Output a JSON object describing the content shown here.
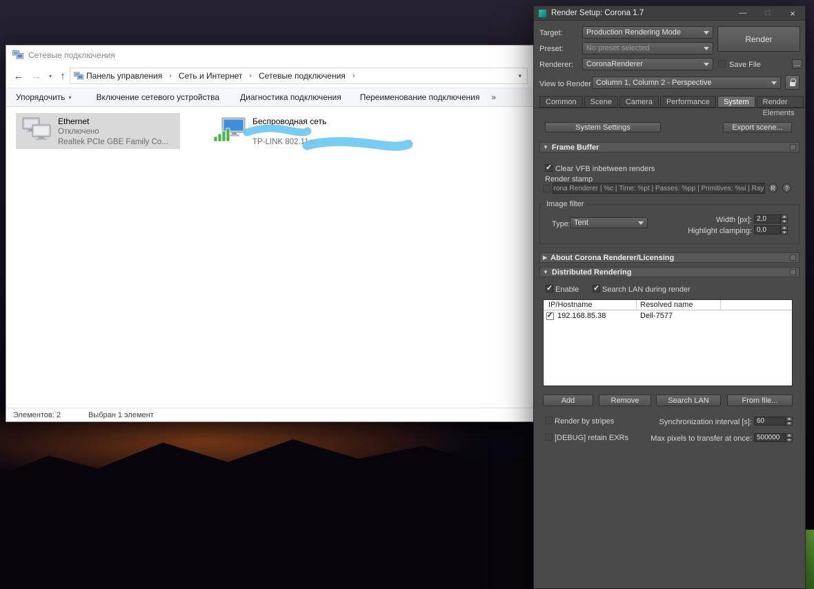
{
  "explorer": {
    "title": "Сетевые подключения",
    "nav": {
      "back": "←",
      "forward": "→",
      "history_caret": "▾",
      "up": "↑"
    },
    "breadcrumb": {
      "separator": "›",
      "caret": "▾",
      "items": [
        {
          "label": "Панель управления"
        },
        {
          "label": "Сеть и Интернет"
        },
        {
          "label": "Сетевые подключения"
        }
      ]
    },
    "toolbar": {
      "organize": "Упорядочить",
      "organize_caret": "▾",
      "buttons": [
        {
          "label": "Включение сетевого устройства"
        },
        {
          "label": "Диагностика подключения"
        },
        {
          "label": "Переименование подключения"
        }
      ],
      "overflow": "»"
    },
    "connections": [
      {
        "name": "Ethernet",
        "status": "Отключено",
        "device": "Realtek PCIe GBE Family Co..."
      },
      {
        "name": "Беспроводная сеть",
        "device": "TP-LINK 802.11ac"
      }
    ],
    "statusbar": {
      "items_count": "Элементов: 2",
      "selection": "Выбран 1 элемент"
    }
  },
  "render_setup": {
    "title": "Render Setup: Corona 1.7",
    "controls": {
      "minimize": "—",
      "maximize": "□",
      "close": "×"
    },
    "icons": {
      "expanded": "▼",
      "collapsed": "▶"
    },
    "fields": {
      "target_label": "Target:",
      "target_value": "Production Rendering Mode",
      "render_button": "Render",
      "preset_label": "Preset:",
      "preset_value": "No preset selected",
      "renderer_label": "Renderer:",
      "renderer_value": "CoronaRenderer",
      "save_file": "Save File",
      "browse": "...",
      "view_label": "View to Render:",
      "view_value": "Column 1, Column 2 - Perspective"
    },
    "tabs": [
      {
        "label": "Common"
      },
      {
        "label": "Scene"
      },
      {
        "label": "Camera"
      },
      {
        "label": "Performance"
      },
      {
        "label": "System"
      },
      {
        "label": "Render Elements"
      }
    ],
    "active_tab": "System",
    "system": {
      "system_settings": "System Settings",
      "export_scene": "Export scene...",
      "frame_buffer": {
        "title": "Frame Buffer",
        "clear_vfb": "Clear VFB inbetween renders",
        "render_stamp": "Render stamp",
        "stamp_text": "Corona Renderer | %c | Time: %pt | Passes: %pp | Primitives: %si | Rays/s",
        "reset": "R",
        "help": "?"
      },
      "image_filter": {
        "title": "Image filter",
        "type_label": "Type:",
        "type_value": "Tent",
        "width_label": "Width [px]:",
        "width_value": "2,0",
        "clamp_label": "Highlight clamping:",
        "clamp_value": "0,0"
      },
      "about_title": "About Corona Renderer/Licensing",
      "distributed": {
        "title": "Distributed Rendering",
        "enable": "Enable",
        "search_lan_render": "Search LAN during render",
        "columns": [
          {
            "label": "IP/Hostname"
          },
          {
            "label": "Resolved name"
          }
        ],
        "rows": [
          {
            "ip": "192.168.85.38",
            "name": "Dell-7577"
          }
        ],
        "add": "Add",
        "remove": "Remove",
        "search_lan": "Search LAN",
        "from_file": "From file...",
        "render_stripes": "Render by stripes",
        "sync_label": "Synchronization interval [s]:",
        "sync_value": "60",
        "debug_label": "[DEBUG] retain EXRs",
        "max_label": "Max pixels to transfer at once:",
        "max_value": "500000"
      }
    }
  }
}
